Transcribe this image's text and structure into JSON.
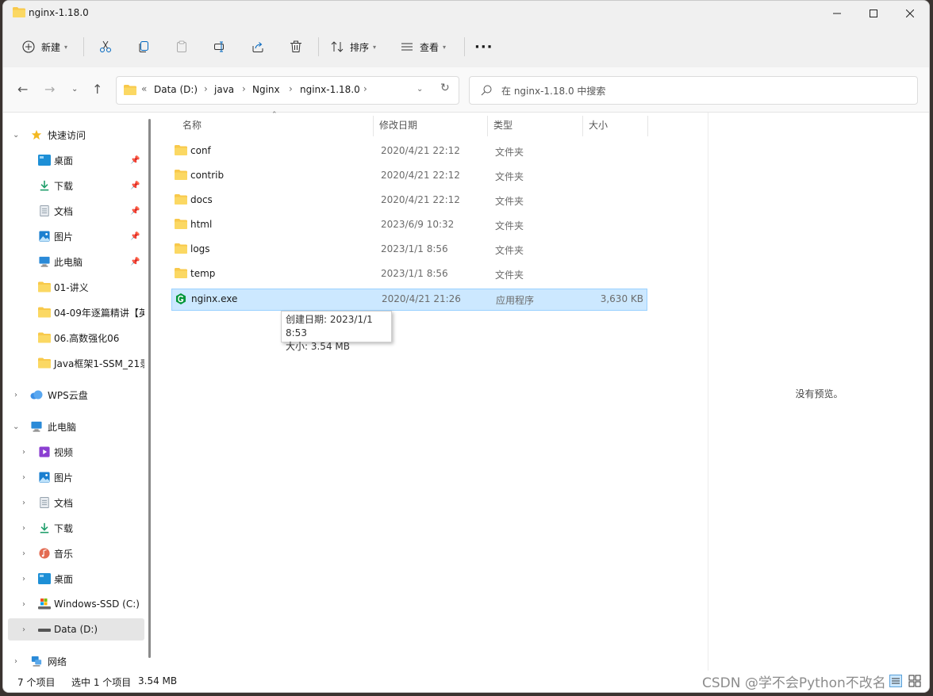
{
  "window": {
    "title": "nginx-1.18.0",
    "controls": [
      "minimize-icon",
      "maximize-icon",
      "close-icon"
    ]
  },
  "toolbar": {
    "new_label": "新建",
    "sort_label": "排序",
    "view_label": "查看",
    "more_label": "···",
    "icons": [
      "plus-icon",
      "cut-icon",
      "copy-icon",
      "paste-icon",
      "rename-icon",
      "share-icon",
      "delete-icon",
      "sort-icon",
      "view-icon"
    ]
  },
  "address": {
    "overflow": "«",
    "crumbs": [
      "Data (D:)",
      "java",
      "Nginx",
      "nginx-1.18.0"
    ],
    "search_placeholder": "在 nginx-1.18.0 中搜索"
  },
  "sidebar": {
    "quick_access": "快速访问",
    "quick_items": [
      {
        "label": "桌面",
        "icon": "desktop-icon",
        "pinned": true
      },
      {
        "label": "下载",
        "icon": "download-icon",
        "pinned": true
      },
      {
        "label": "文档",
        "icon": "document-icon",
        "pinned": true
      },
      {
        "label": "图片",
        "icon": "pictures-icon",
        "pinned": true
      },
      {
        "label": "此电脑",
        "icon": "computer-icon",
        "pinned": true
      },
      {
        "label": "01-讲义",
        "icon": "folder-icon",
        "pinned": false
      },
      {
        "label": "04-09年逐篇精讲【英",
        "icon": "folder-icon",
        "pinned": false
      },
      {
        "label": "06.高数强化06",
        "icon": "folder-icon",
        "pinned": false
      },
      {
        "label": "Java框架1-SSM_21录",
        "icon": "folder-icon",
        "pinned": false
      }
    ],
    "wps": "WPS云盘",
    "this_pc": "此电脑",
    "pc_items": [
      {
        "label": "视频",
        "icon": "video-icon"
      },
      {
        "label": "图片",
        "icon": "pictures-icon"
      },
      {
        "label": "文档",
        "icon": "document-icon"
      },
      {
        "label": "下载",
        "icon": "download-icon"
      },
      {
        "label": "音乐",
        "icon": "music-icon"
      },
      {
        "label": "桌面",
        "icon": "desktop-icon"
      },
      {
        "label": "Windows-SSD (C:)",
        "icon": "drive-icon"
      },
      {
        "label": "Data (D:)",
        "icon": "drive-icon"
      }
    ],
    "network": "网络"
  },
  "columns": {
    "name": "名称",
    "date": "修改日期",
    "type": "类型",
    "size": "大小"
  },
  "files": [
    {
      "name": "conf",
      "date": "2020/4/21 22:12",
      "type": "文件夹",
      "size": ""
    },
    {
      "name": "contrib",
      "date": "2020/4/21 22:12",
      "type": "文件夹",
      "size": ""
    },
    {
      "name": "docs",
      "date": "2020/4/21 22:12",
      "type": "文件夹",
      "size": ""
    },
    {
      "name": "html",
      "date": "2023/6/9 10:32",
      "type": "文件夹",
      "size": ""
    },
    {
      "name": "logs",
      "date": "2023/1/1 8:56",
      "type": "文件夹",
      "size": ""
    },
    {
      "name": "temp",
      "date": "2023/1/1 8:56",
      "type": "文件夹",
      "size": ""
    },
    {
      "name": "nginx.exe",
      "date": "2020/4/21 21:26",
      "type": "应用程序",
      "size": "3,630 KB"
    }
  ],
  "tooltip": {
    "created": "创建日期: 2023/1/1 8:53",
    "size": "大小: 3.54 MB"
  },
  "preview": {
    "empty_text": "没有预览。"
  },
  "status": {
    "count": "7 个项目",
    "selected": "选中 1 个项目",
    "selected_size": "3.54 MB"
  },
  "watermark": "CSDN @学不会Python不改名",
  "colors": {
    "selection_bg": "#cce8ff",
    "folder": "#f8c94b",
    "nginx_green": "#009639"
  }
}
